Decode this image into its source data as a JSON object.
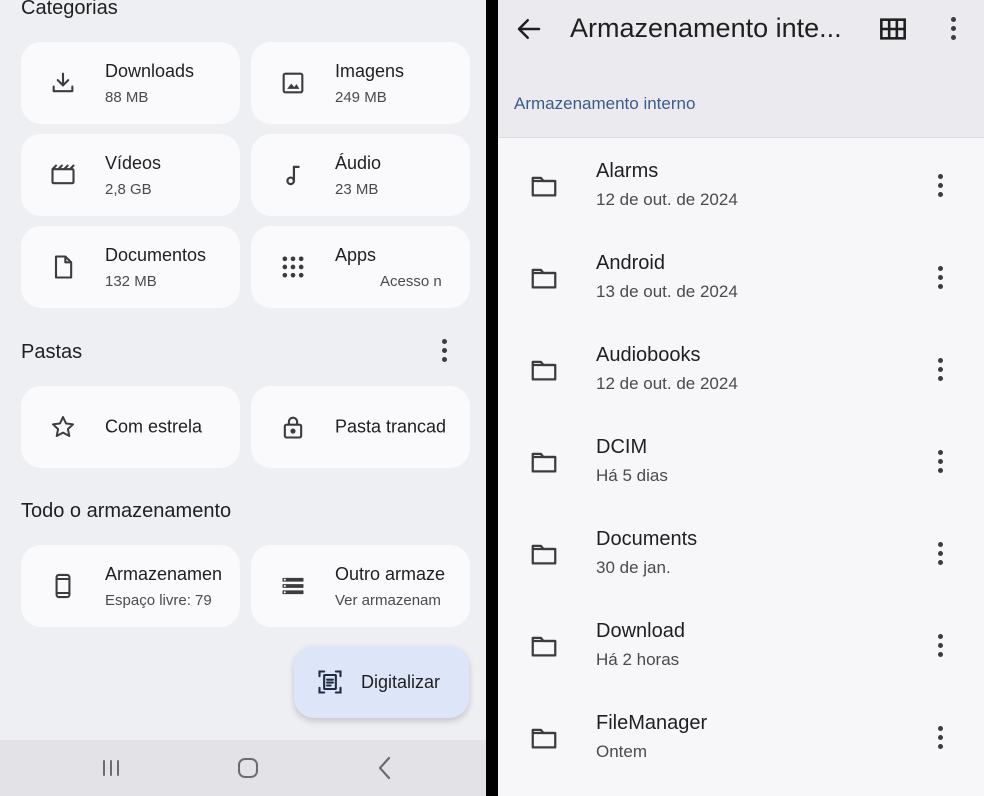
{
  "left": {
    "categories_title": "Categorias",
    "categories": [
      {
        "icon": "download-icon",
        "title": "Downloads",
        "sub": "88 MB"
      },
      {
        "icon": "image-icon",
        "title": "Imagens",
        "sub": "249 MB"
      },
      {
        "icon": "video-icon",
        "title": "Vídeos",
        "sub": "2,8 GB"
      },
      {
        "icon": "music-note-icon",
        "title": "Áudio",
        "sub": "23 MB"
      },
      {
        "icon": "document-icon",
        "title": "Documentos",
        "sub": "132 MB"
      },
      {
        "icon": "apps-grid-icon",
        "title": "Apps",
        "sub": "Acesso n"
      }
    ],
    "folders_title": "Pastas",
    "folders": [
      {
        "icon": "star-icon",
        "title": "Com estrela"
      },
      {
        "icon": "lock-icon",
        "title": "Pasta trancad"
      }
    ],
    "storage_title": "Todo o armazenamento",
    "storage": [
      {
        "icon": "phone-icon",
        "title": "Armazenamen",
        "sub": "Espaço livre: 79"
      },
      {
        "icon": "storage-list-icon",
        "title": "Outro armaze",
        "sub": "Ver armazenam"
      }
    ],
    "fab_label": "Digitalizar"
  },
  "right": {
    "title": "Armazenamento inte...",
    "breadcrumb": "Armazenamento interno",
    "items": [
      {
        "name": "Alarms",
        "date": "12 de out. de 2024"
      },
      {
        "name": "Android",
        "date": "13 de out. de 2024"
      },
      {
        "name": "Audiobooks",
        "date": "12 de out. de 2024"
      },
      {
        "name": "DCIM",
        "date": "Há 5 dias"
      },
      {
        "name": "Documents",
        "date": "30 de jan."
      },
      {
        "name": "Download",
        "date": "Há 2 horas"
      },
      {
        "name": "FileManager",
        "date": "Ontem"
      }
    ]
  },
  "colors": {
    "accent_text": "#3d5a8a",
    "fab_background": "#dde5f9",
    "card_background": "#fafafc",
    "panel_background": "#eeeff3"
  }
}
